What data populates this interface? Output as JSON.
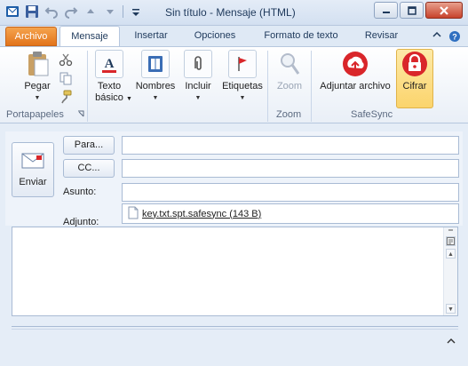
{
  "window": {
    "title": "Sin título  -  Mensaje (HTML)"
  },
  "qat": {
    "icons": [
      "outlook-icon",
      "save-icon",
      "undo-icon",
      "redo-icon",
      "up-icon",
      "down-icon",
      "customize-qat-icon"
    ]
  },
  "tabs": [
    {
      "label": "Archivo"
    },
    {
      "label": "Mensaje"
    },
    {
      "label": "Insertar"
    },
    {
      "label": "Opciones"
    },
    {
      "label": "Formato de texto"
    },
    {
      "label": "Revisar"
    }
  ],
  "ribbon": {
    "clipboard": {
      "paste_label": "Pegar",
      "group_label": "Portapapeles"
    },
    "basic_text": {
      "line1": "Texto",
      "line2": "básico"
    },
    "names": {
      "label": "Nombres"
    },
    "include": {
      "label": "Incluir"
    },
    "tags": {
      "label": "Etiquetas"
    },
    "zoom": {
      "label": "Zoom",
      "group_label": "Zoom"
    },
    "safesync": {
      "attach_label": "Adjuntar archivo",
      "encrypt_label": "Cifrar",
      "group_label": "SafeSync"
    }
  },
  "compose": {
    "send_label": "Enviar",
    "to_button": "Para...",
    "cc_button": "CC...",
    "to_value": "",
    "cc_value": "",
    "subject_label": "Asunto:",
    "subject_value": "",
    "attached_label": "Adjunto:",
    "attachment": "key.txt.spt.safesync (143 B)"
  },
  "colors": {
    "file_tab": "#e2741b",
    "highlight": "#fbd46c",
    "safesync_red": "#d9262a"
  }
}
